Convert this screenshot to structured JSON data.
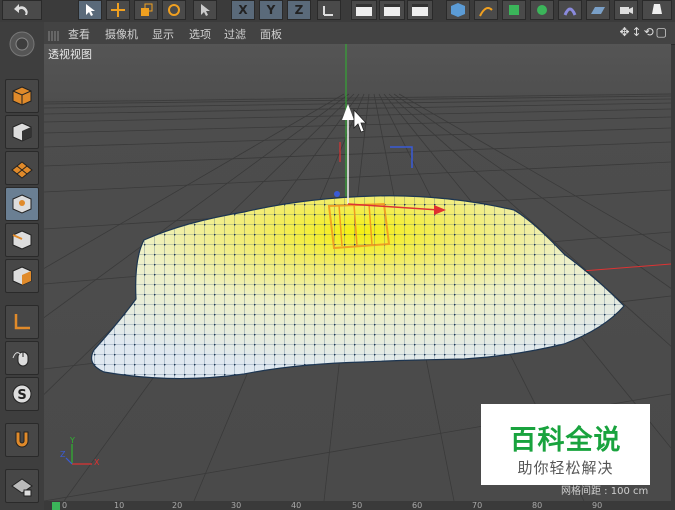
{
  "menu": {
    "items": [
      {
        "label": "查看"
      },
      {
        "label": "摄像机"
      },
      {
        "label": "显示"
      },
      {
        "label": "选项"
      },
      {
        "label": "过滤"
      },
      {
        "label": "面板"
      }
    ]
  },
  "viewport": {
    "label": "透视视图",
    "grid_spacing": "网格间距 : 100 cm"
  },
  "toolbar": {
    "axis_x": "X",
    "axis_y": "Y",
    "axis_z": "Z"
  },
  "axis_gizmo": {
    "x": "X",
    "y": "Y",
    "z": "Z"
  },
  "watermark": {
    "title": "百科全说",
    "subtitle": "助你轻松解决"
  },
  "timeline": {
    "ticks": [
      "0",
      "10",
      "20",
      "30",
      "40",
      "50",
      "60",
      "70",
      "80",
      "90"
    ]
  },
  "colors": {
    "axis_x": "#e03030",
    "axis_y": "#2fb52f",
    "axis_z": "#3a5bd6",
    "mesh_highlight": "#f1e200"
  }
}
